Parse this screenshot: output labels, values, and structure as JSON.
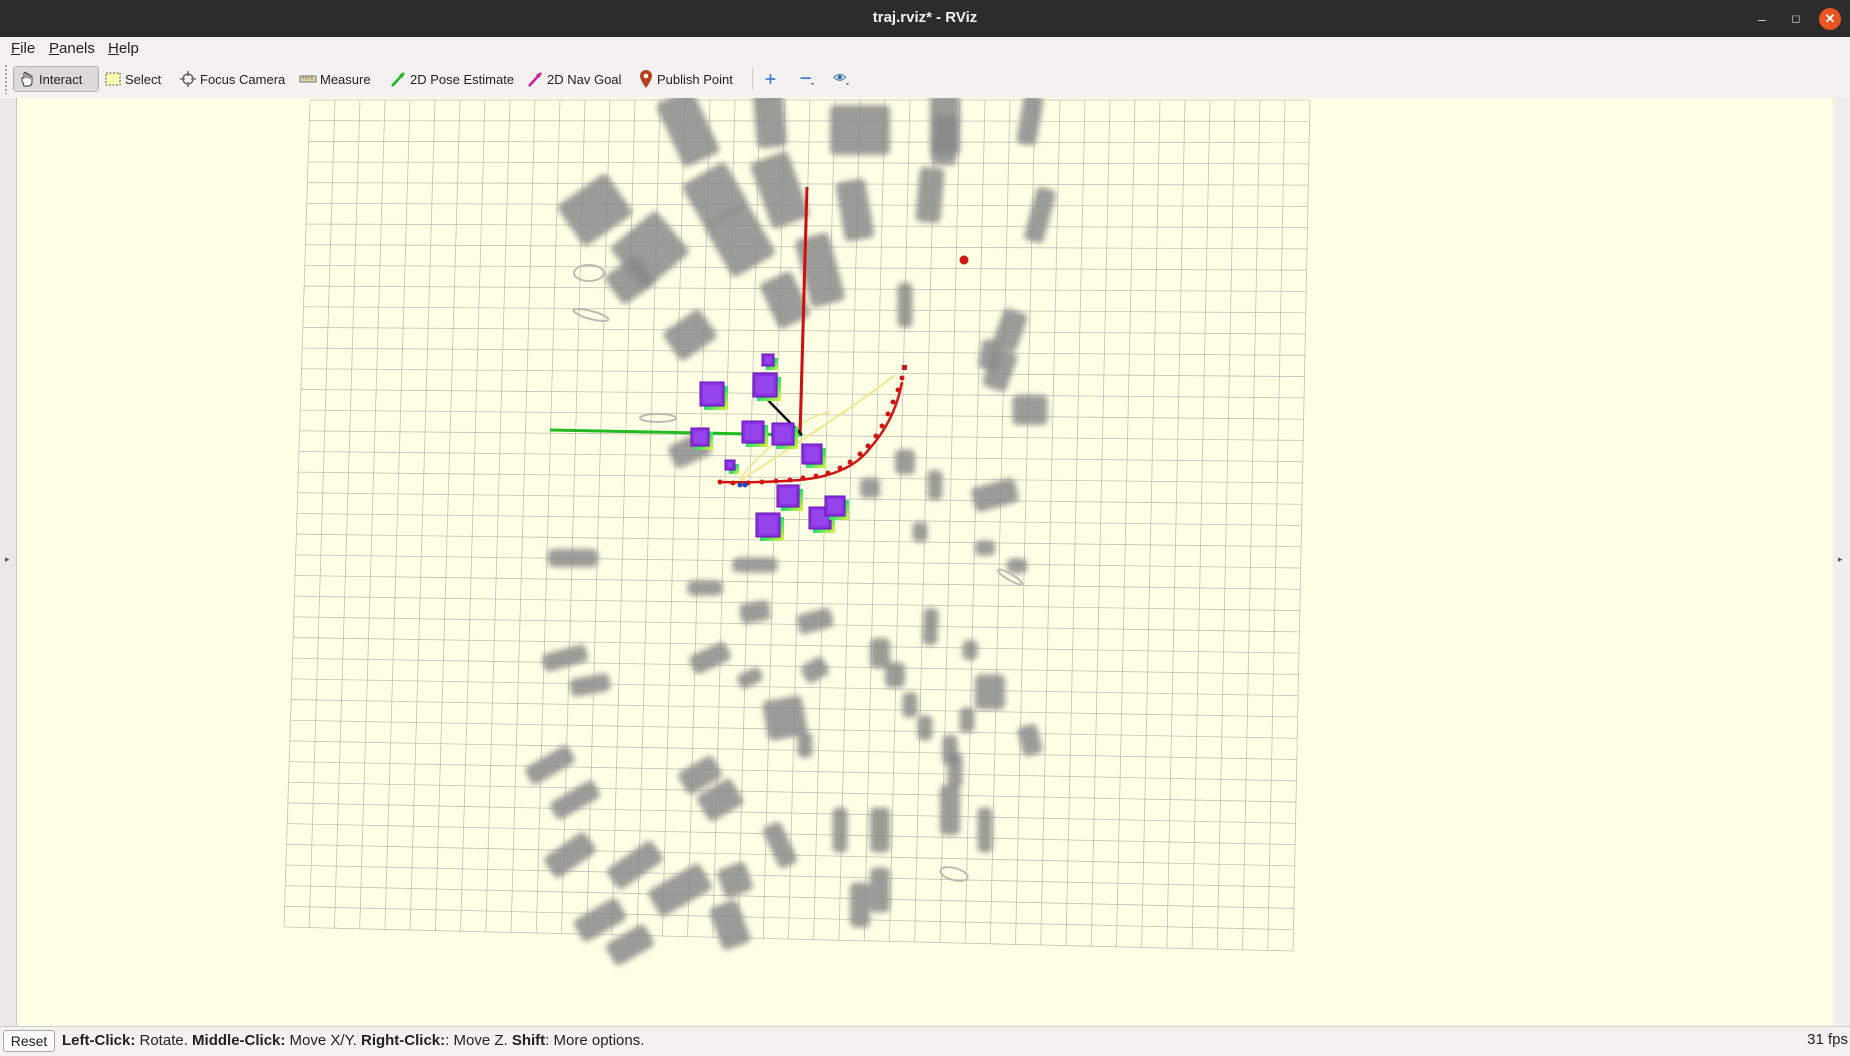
{
  "window": {
    "title": "traj.rviz* - RViz"
  },
  "menu": [
    {
      "label": "File",
      "mnemonic": "F",
      "rest": "ile"
    },
    {
      "label": "Panels",
      "mnemonic": "P",
      "rest": "anels"
    },
    {
      "label": "Help",
      "mnemonic": "H",
      "rest": "elp"
    }
  ],
  "toolbar": {
    "interact": "Interact",
    "select": "Select",
    "focus_camera": "Focus Camera",
    "measure": "Measure",
    "pose_estimate": "2D Pose Estimate",
    "nav_goal": "2D Nav Goal",
    "publish_point": "Publish Point"
  },
  "status": {
    "reset": "Reset",
    "hint": [
      {
        "key": "Left-Click:",
        "action": " Rotate. "
      },
      {
        "key": "Middle-Click:",
        "action": " Move X/Y. "
      },
      {
        "key": "Right-Click:",
        "action": ": Move Z. "
      },
      {
        "key": "Shift",
        "action": ": More options."
      }
    ],
    "fps": "31 fps"
  },
  "colors": {
    "background": "#ffffe6",
    "grid": "#a8a8a0",
    "x_axis": "#cc1010",
    "y_axis": "#22bb22",
    "trajectory": "#d01515",
    "reference_path": "#f0e68c",
    "obstacle": "#8a8a8a",
    "cube_top": "#8a30e0",
    "accent_close": "#e95420"
  }
}
